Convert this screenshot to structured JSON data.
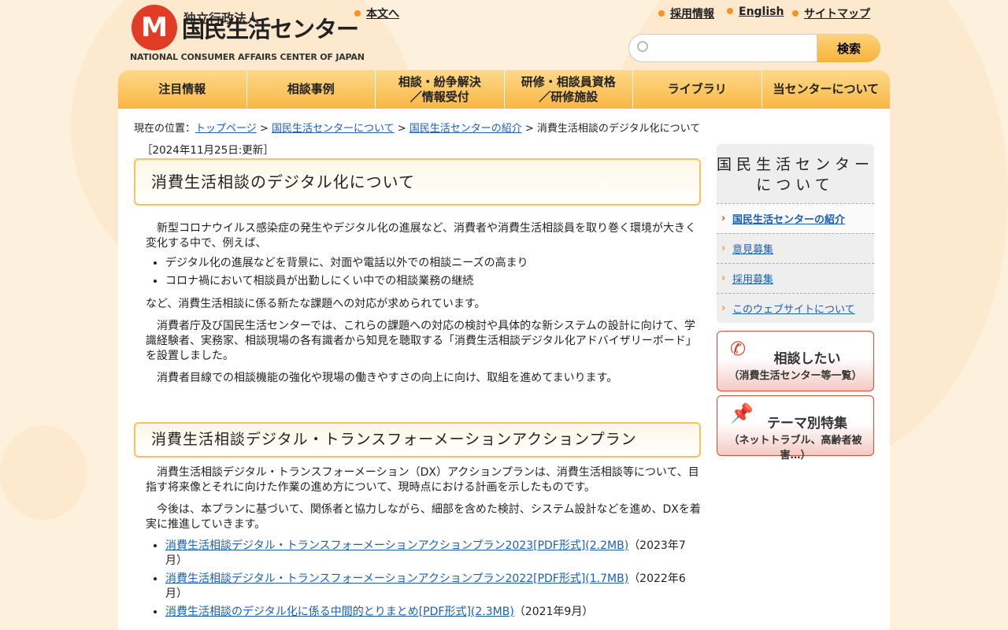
{
  "header": {
    "logo_sub": "独立行政法人",
    "logo_main": "国民生活センター",
    "logo_en": "NATIONAL CONSUMER AFFAIRS CENTER OF JAPAN",
    "skip_link": "本文へ",
    "links": [
      "採用情報",
      "English",
      "サイトマップ"
    ],
    "search_placeholder": "",
    "search_button": "検索"
  },
  "nav": [
    "注目情報",
    "相談事例",
    "相談・紛争解決\n／情報受付",
    "研修・相談員資格\n／研修施設",
    "ライブラリ",
    "当センターについて"
  ],
  "breadcrumb": {
    "label": "現在の位置：",
    "items": [
      "トップページ",
      "国民生活センターについて",
      "国民生活センターの紹介"
    ],
    "current": "消費生活相談のデジタル化について"
  },
  "main": {
    "updated": "［2024年11月25日:更新］",
    "title": "消費生活相談のデジタル化について",
    "p1": "新型コロナウイルス感染症の発生やデジタル化の進展など、消費者や消費生活相談員を取り巻く環境が大きく変化する中で、例えば、",
    "bullets": [
      "デジタル化の進展などを背景に、対面や電話以外での相談ニーズの高まり",
      "コロナ禍において相談員が出勤しにくい中での相談業務の継続"
    ],
    "p2": "など、消費生活相談に係る新たな課題への対応が求められています。",
    "p3": "消費者庁及び国民生活センターでは、これらの課題への対応の検討や具体的な新システムの設計に向けて、学識経験者、実務家、相談現場の各有識者から知見を聴取する「消費生活相談デジタル化アドバイザリーボード」を設置しました。",
    "p4": "消費者目線での相談機能の強化や現場の働きやすさの向上に向け、取組を進めてまいります。",
    "h2": "消費生活相談デジタル・トランスフォーメーションアクションプラン",
    "p5": "消費生活相談デジタル・トランスフォーメーション（DX）アクションプランは、消費生活相談等について、目指す将来像とそれに向けた作業の進め方について、現時点における計画を示したものです。",
    "p6": "今後は、本プランに基づいて、関係者と協力しながら、細部を含めた検討、システム設計などを進め、DXを着実に推進していきます。",
    "docs": [
      {
        "link": "消費生活相談デジタル・トランスフォーメーションアクションプラン2023[PDF形式](2.2MB)",
        "date": "（2023年7月）"
      },
      {
        "link": "消費生活相談デジタル・トランスフォーメーションアクションプラン2022[PDF形式](1.7MB)",
        "date": "（2022年6月）"
      },
      {
        "link": "消費生活相談のデジタル化に係る中間的とりまとめ[PDF形式](2.3MB)",
        "date": "（2021年9月）"
      }
    ]
  },
  "side": {
    "title": "国民生活センターについて",
    "items": [
      "国民生活センターの紹介",
      "意見募集",
      "採用募集",
      "このウェブサイトについて"
    ],
    "banner1": {
      "title": "相談したい",
      "sub": "（消費生活センター等一覧）"
    },
    "banner2": {
      "title": "テーマ別特集",
      "sub": "（ネットトラブル、高齢者被害…）"
    }
  }
}
